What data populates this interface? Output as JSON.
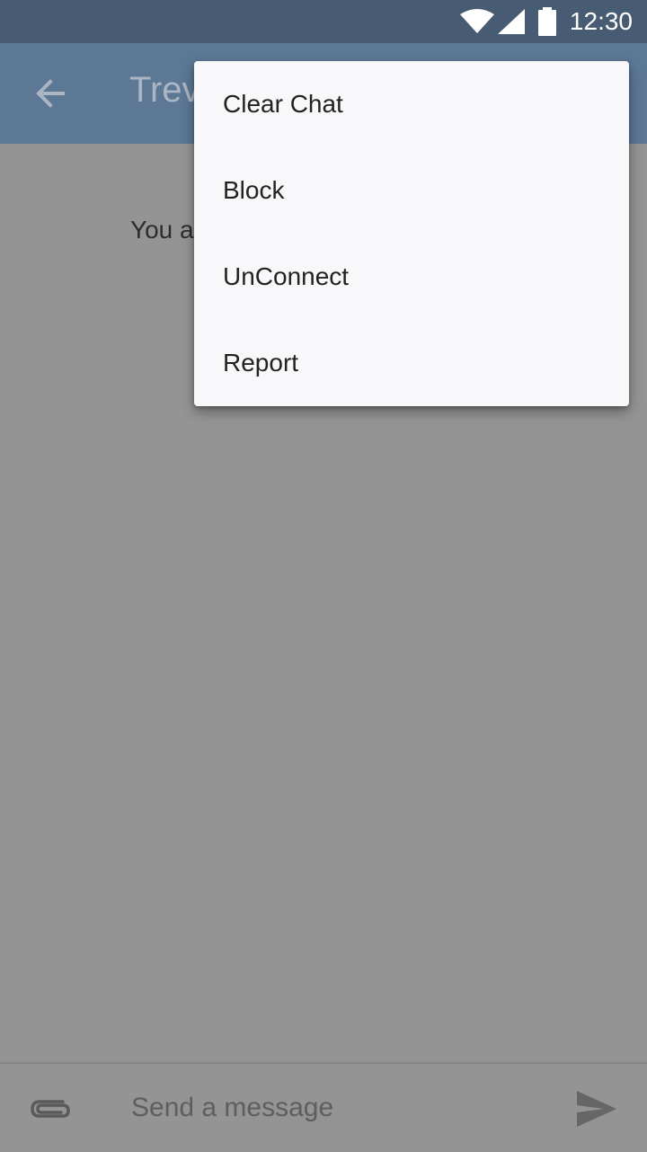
{
  "status_bar": {
    "time": "12:30",
    "icons": [
      "wifi-icon",
      "signal-icon",
      "battery-icon"
    ]
  },
  "app_bar": {
    "title": "Trev",
    "back_icon": "arrow-left-icon"
  },
  "chat": {
    "empty_text": "You ar"
  },
  "menu": {
    "items": [
      {
        "label": "Clear Chat"
      },
      {
        "label": "Block"
      },
      {
        "label": "UnConnect"
      },
      {
        "label": "Report"
      }
    ]
  },
  "composer": {
    "placeholder": "Send a message",
    "attach_icon": "paperclip-icon",
    "send_icon": "send-icon"
  },
  "colors": {
    "status_bar": "#475c73",
    "app_bar": "#5c7895",
    "scrim_background": "#949494",
    "menu_background": "#f8f8fa"
  }
}
